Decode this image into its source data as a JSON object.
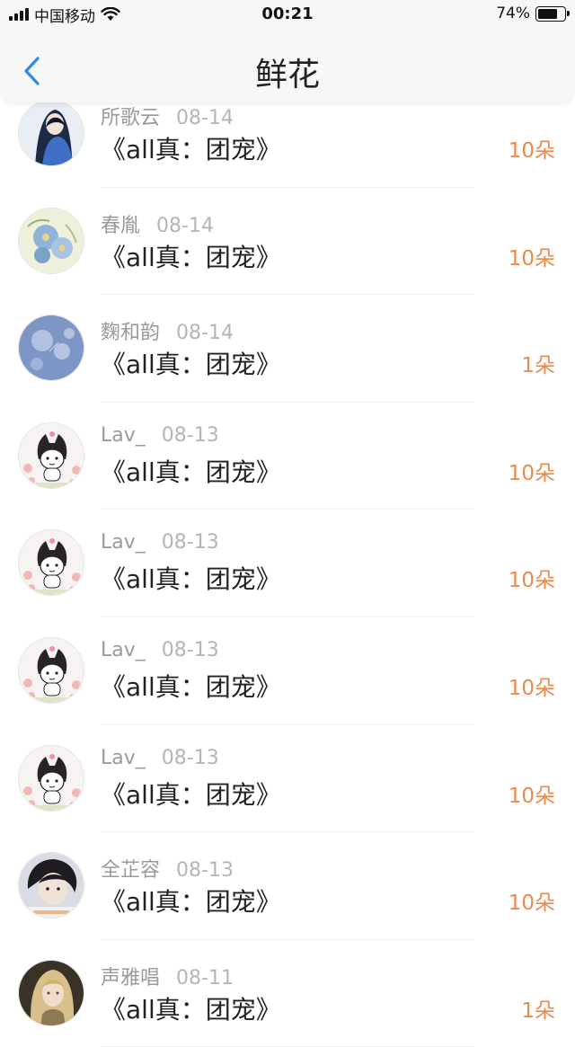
{
  "status_bar": {
    "carrier": "中国移动",
    "time": "00:21",
    "battery_percent": "74%",
    "battery_level": 0.74
  },
  "nav": {
    "title": "鲜花",
    "back_icon": "chevron-left-icon"
  },
  "colors": {
    "accent_orange": "#e98a4d",
    "back_blue": "#2f8ae5"
  },
  "rows": [
    {
      "name": "所歌云",
      "date": "08-14",
      "book": "《all真：团宠》",
      "amount": "10朵",
      "avatar": "anime-blue-girl"
    },
    {
      "name": "春胤",
      "date": "08-14",
      "book": "《all真：团宠》",
      "amount": "10朵",
      "avatar": "blue-flowers"
    },
    {
      "name": "麴和韵",
      "date": "08-14",
      "book": "《all真：团宠》",
      "amount": "1朵",
      "avatar": "blue-bubbles"
    },
    {
      "name": "Lav_",
      "date": "08-13",
      "book": "《all真：团宠》",
      "amount": "10朵",
      "avatar": "kuromi"
    },
    {
      "name": "Lav_",
      "date": "08-13",
      "book": "《all真：团宠》",
      "amount": "10朵",
      "avatar": "kuromi"
    },
    {
      "name": "Lav_",
      "date": "08-13",
      "book": "《all真：团宠》",
      "amount": "10朵",
      "avatar": "kuromi"
    },
    {
      "name": "Lav_",
      "date": "08-13",
      "book": "《all真：团宠》",
      "amount": "10朵",
      "avatar": "kuromi"
    },
    {
      "name": "全芷容",
      "date": "08-13",
      "book": "《all真：团宠》",
      "amount": "10朵",
      "avatar": "dark-hair-boy"
    },
    {
      "name": "声雅唱",
      "date": "08-11",
      "book": "《all真：团宠》",
      "amount": "1朵",
      "avatar": "blonde-elf"
    }
  ]
}
